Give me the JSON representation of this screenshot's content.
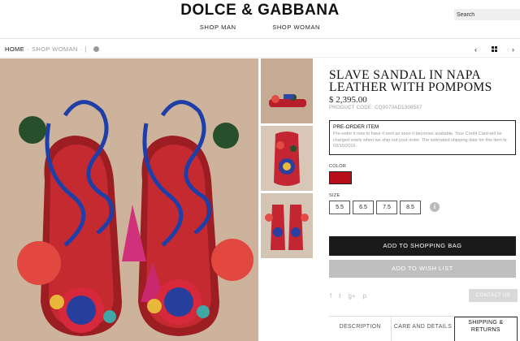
{
  "header": {
    "logo_text": "DOLCE & GABBANA",
    "search_placeholder": "Search",
    "nav": [
      "SHOP MAN",
      "SHOP WOMAN"
    ]
  },
  "breadcrumb": {
    "home": "HOME",
    "sep1": "·",
    "section": "SHOP WOMAN",
    "sep2": "· |"
  },
  "pager": {
    "prev": "‹",
    "next": "›"
  },
  "product": {
    "title": "SLAVE SANDAL IN NAPA LEATHER WITH POMPOMS",
    "price": "$ 2,395.00",
    "code": "PRODUCT CODE: CQ0070AD1308587",
    "preorder": {
      "heading": "PRE-ORDER ITEM",
      "body": "Pre-order it now to have it sent as soon it becomes available. Your Credit Card will be charged solely when we ship out your order. The estimated shipping date for this item is: 03/15/2016."
    },
    "color_label": "COLOR",
    "color_swatch": "#b80f1a",
    "size_label": "SIZE",
    "sizes": [
      "5.5",
      "6.5",
      "7.5",
      "8.5"
    ],
    "size_info_glyph": "i"
  },
  "actions": {
    "add_to_bag": "ADD TO SHOPPING BAG",
    "add_to_wishlist": "ADD TO WISH LIST",
    "contact": "CONTACT US"
  },
  "social": [
    "f",
    "t",
    "g+",
    "p"
  ],
  "tabs": [
    "DESCRIPTION",
    "CARE AND DETAILS",
    "SHIPPING & RETURNS"
  ],
  "icons": {
    "pager_prev": "chevron-left-icon",
    "pager_next": "chevron-right-icon",
    "grid": "grid-icon",
    "info": "info-icon"
  },
  "colors": {
    "bag_button": "#1a1a1a",
    "wish_button": "#bfbfbf",
    "image_background": "#cdb59f"
  }
}
